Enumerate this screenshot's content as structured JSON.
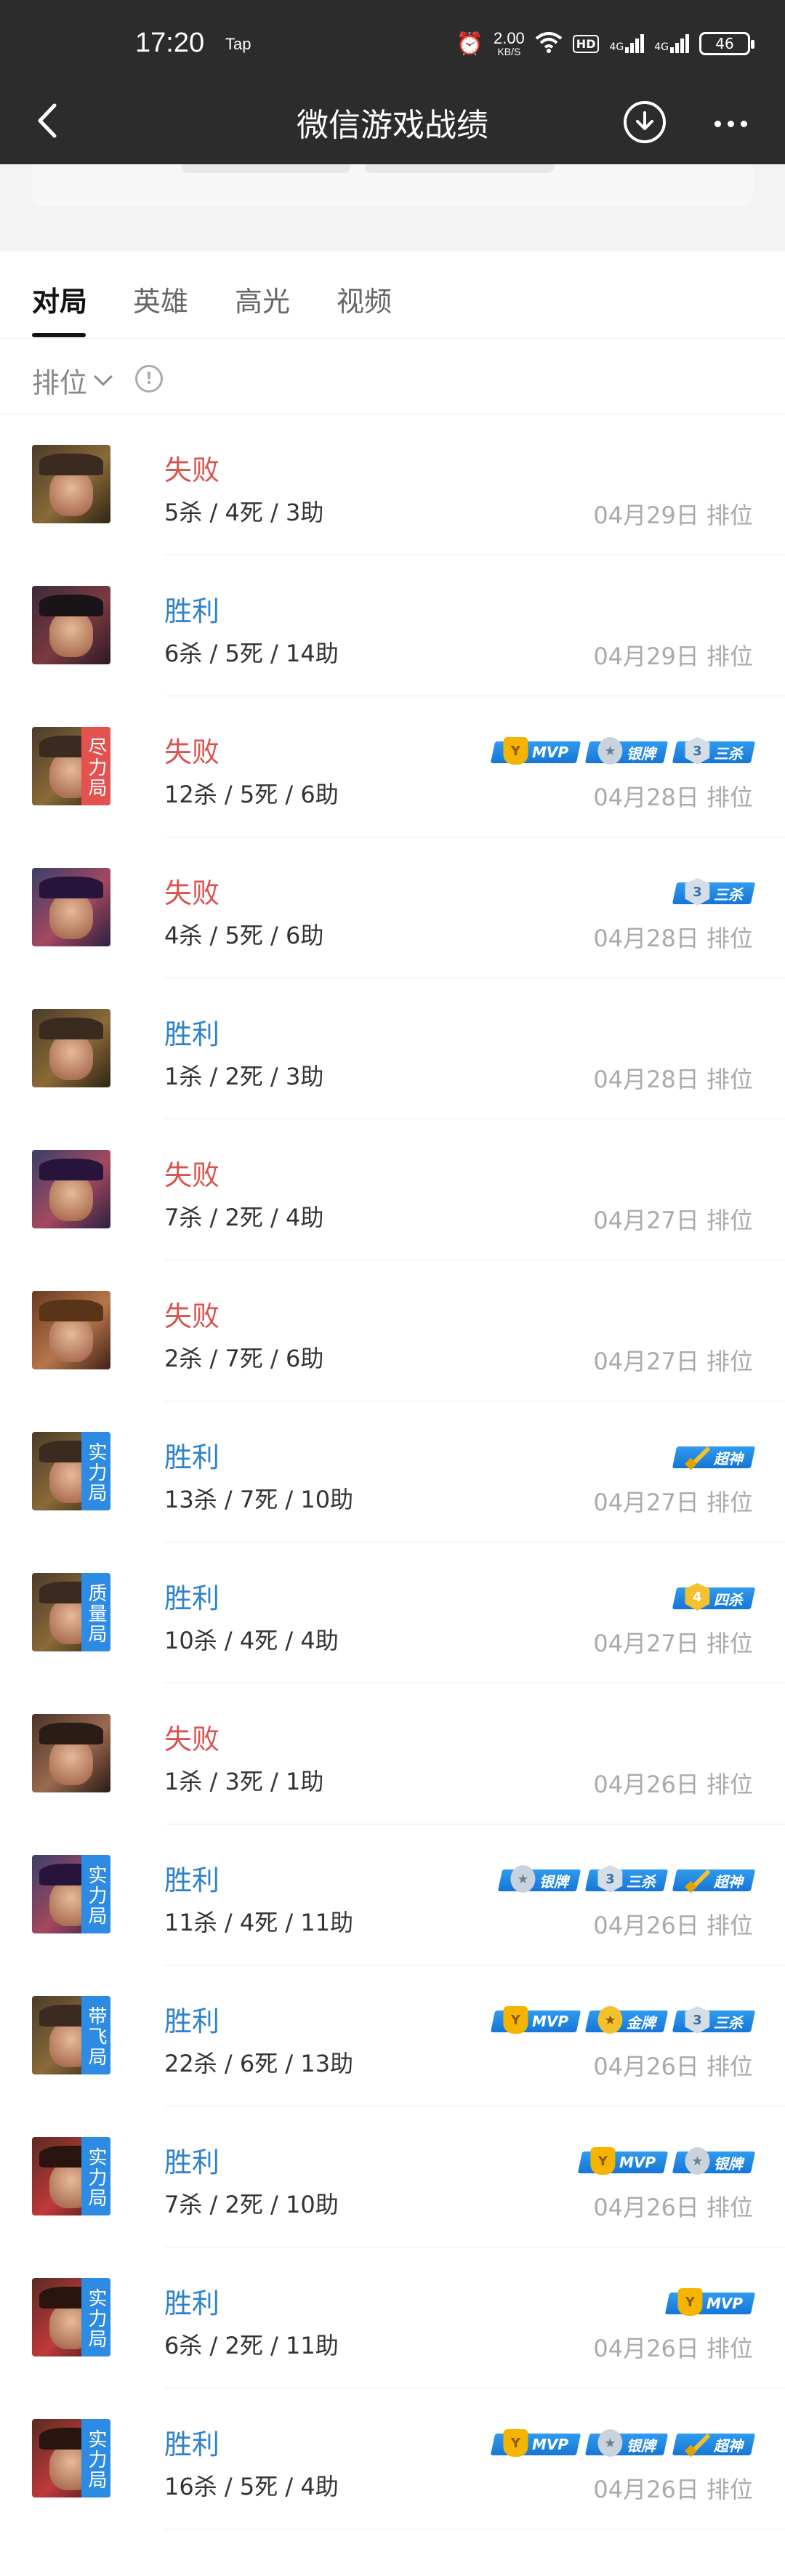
{
  "status_bar": {
    "time": "17:20",
    "app_tag": "Tap",
    "net_speed": "2.00",
    "net_unit": "KB/S",
    "hd": "HD",
    "sig1": "4G",
    "sig2": "4G",
    "battery": "46"
  },
  "header": {
    "title": "微信游戏战绩"
  },
  "tabs": [
    {
      "label": "对局",
      "active": true
    },
    {
      "label": "英雄",
      "active": false
    },
    {
      "label": "高光",
      "active": false
    },
    {
      "label": "视频",
      "active": false
    }
  ],
  "filter": {
    "label": "排位",
    "info_glyph": "!"
  },
  "badge_labels": {
    "mvp": "MVP",
    "silver": "银牌",
    "gold": "金牌",
    "triple": "三杀",
    "quadra": "四杀",
    "legendary": "超神"
  },
  "matches": [
    {
      "hero": "a",
      "tag": "",
      "tag_color": "",
      "result": "失败",
      "outcome": "lose",
      "kda": "5杀 / 4死 / 3助",
      "date": "04月29日",
      "mode": "排位",
      "badges": []
    },
    {
      "hero": "b",
      "tag": "",
      "tag_color": "",
      "result": "胜利",
      "outcome": "win",
      "kda": "6杀 / 5死 / 14助",
      "date": "04月29日",
      "mode": "排位",
      "badges": []
    },
    {
      "hero": "a",
      "tag": "尽力局",
      "tag_color": "red",
      "result": "失败",
      "outcome": "lose",
      "kda": "12杀 / 5死 / 6助",
      "date": "04月28日",
      "mode": "排位",
      "badges": [
        "mvp",
        "silver",
        "triple"
      ]
    },
    {
      "hero": "c",
      "tag": "",
      "tag_color": "",
      "result": "失败",
      "outcome": "lose",
      "kda": "4杀 / 5死 / 6助",
      "date": "04月28日",
      "mode": "排位",
      "badges": [
        "triple"
      ]
    },
    {
      "hero": "a",
      "tag": "",
      "tag_color": "",
      "result": "胜利",
      "outcome": "win",
      "kda": "1杀 / 2死 / 3助",
      "date": "04月28日",
      "mode": "排位",
      "badges": []
    },
    {
      "hero": "c",
      "tag": "",
      "tag_color": "",
      "result": "失败",
      "outcome": "lose",
      "kda": "7杀 / 2死 / 4助",
      "date": "04月27日",
      "mode": "排位",
      "badges": []
    },
    {
      "hero": "d",
      "tag": "",
      "tag_color": "",
      "result": "失败",
      "outcome": "lose",
      "kda": "2杀 / 7死 / 6助",
      "date": "04月27日",
      "mode": "排位",
      "badges": []
    },
    {
      "hero": "a",
      "tag": "实力局",
      "tag_color": "blue",
      "result": "胜利",
      "outcome": "win",
      "kda": "13杀 / 7死 / 10助",
      "date": "04月27日",
      "mode": "排位",
      "badges": [
        "legendary"
      ]
    },
    {
      "hero": "a",
      "tag": "质量局",
      "tag_color": "blue",
      "result": "胜利",
      "outcome": "win",
      "kda": "10杀 / 4死 / 4助",
      "date": "04月27日",
      "mode": "排位",
      "badges": [
        "quadra"
      ]
    },
    {
      "hero": "e",
      "tag": "",
      "tag_color": "",
      "result": "失败",
      "outcome": "lose",
      "kda": "1杀 / 3死 / 1助",
      "date": "04月26日",
      "mode": "排位",
      "badges": []
    },
    {
      "hero": "c",
      "tag": "实力局",
      "tag_color": "blue",
      "result": "胜利",
      "outcome": "win",
      "kda": "11杀 / 4死 / 11助",
      "date": "04月26日",
      "mode": "排位",
      "badges": [
        "silver",
        "triple",
        "legendary"
      ]
    },
    {
      "hero": "a",
      "tag": "带飞局",
      "tag_color": "blue",
      "result": "胜利",
      "outcome": "win",
      "kda": "22杀 / 6死 / 13助",
      "date": "04月26日",
      "mode": "排位",
      "badges": [
        "mvp",
        "gold",
        "triple"
      ]
    },
    {
      "hero": "f",
      "tag": "实力局",
      "tag_color": "blue",
      "result": "胜利",
      "outcome": "win",
      "kda": "7杀 / 2死 / 10助",
      "date": "04月26日",
      "mode": "排位",
      "badges": [
        "mvp",
        "silver"
      ]
    },
    {
      "hero": "f",
      "tag": "实力局",
      "tag_color": "blue",
      "result": "胜利",
      "outcome": "win",
      "kda": "6杀 / 2死 / 11助",
      "date": "04月26日",
      "mode": "排位",
      "badges": [
        "mvp"
      ]
    },
    {
      "hero": "f",
      "tag": "实力局",
      "tag_color": "blue",
      "result": "胜利",
      "outcome": "win",
      "kda": "16杀 / 5死 / 4助",
      "date": "04月26日",
      "mode": "排位",
      "badges": [
        "mvp",
        "silver",
        "legendary"
      ]
    }
  ]
}
